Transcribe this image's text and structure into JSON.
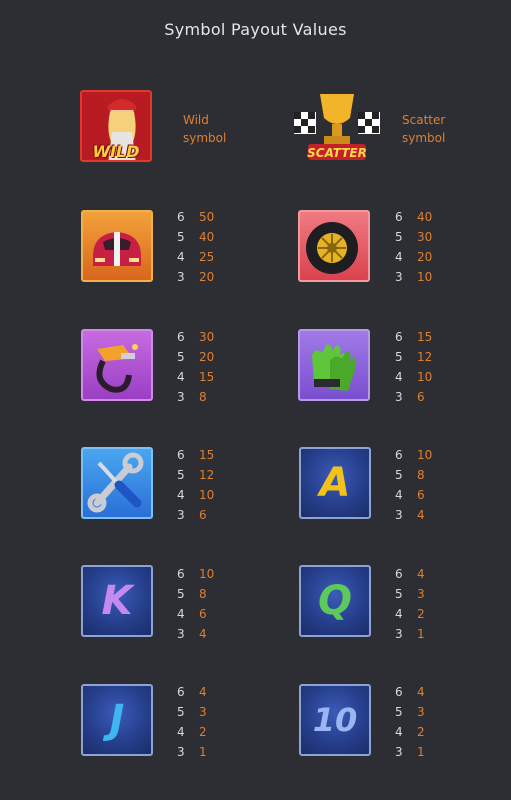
{
  "title": "Symbol Payout Values",
  "special": [
    {
      "name": "wild",
      "logo_text": "WILD",
      "label_line1": "Wild",
      "label_line2": "symbol"
    },
    {
      "name": "scatter",
      "logo_text": "SCATTER",
      "label_line1": "Scatter",
      "label_line2": "symbol"
    }
  ],
  "symbols": [
    {
      "icon": "race-car-icon",
      "pays": [
        [
          "6",
          "50"
        ],
        [
          "5",
          "40"
        ],
        [
          "4",
          "25"
        ],
        [
          "3",
          "20"
        ]
      ]
    },
    {
      "icon": "tire-icon",
      "pays": [
        [
          "6",
          "40"
        ],
        [
          "5",
          "30"
        ],
        [
          "4",
          "20"
        ],
        [
          "3",
          "10"
        ]
      ]
    },
    {
      "icon": "fuel-nozzle-icon",
      "pays": [
        [
          "6",
          "30"
        ],
        [
          "5",
          "20"
        ],
        [
          "4",
          "15"
        ],
        [
          "3",
          "8"
        ]
      ]
    },
    {
      "icon": "racing-gloves-icon",
      "pays": [
        [
          "6",
          "15"
        ],
        [
          "5",
          "12"
        ],
        [
          "4",
          "10"
        ],
        [
          "3",
          "6"
        ]
      ]
    },
    {
      "icon": "wrench-screwdriver-icon",
      "pays": [
        [
          "6",
          "15"
        ],
        [
          "5",
          "12"
        ],
        [
          "4",
          "10"
        ],
        [
          "3",
          "6"
        ]
      ]
    },
    {
      "icon": "card-a-icon",
      "letter": "A",
      "pays": [
        [
          "6",
          "10"
        ],
        [
          "5",
          "8"
        ],
        [
          "4",
          "6"
        ],
        [
          "3",
          "4"
        ]
      ]
    },
    {
      "icon": "card-k-icon",
      "letter": "K",
      "pays": [
        [
          "6",
          "10"
        ],
        [
          "5",
          "8"
        ],
        [
          "4",
          "6"
        ],
        [
          "3",
          "4"
        ]
      ]
    },
    {
      "icon": "card-q-icon",
      "letter": "Q",
      "pays": [
        [
          "6",
          "4"
        ],
        [
          "5",
          "3"
        ],
        [
          "4",
          "2"
        ],
        [
          "3",
          "1"
        ]
      ]
    },
    {
      "icon": "card-j-icon",
      "letter": "J",
      "pays": [
        [
          "6",
          "4"
        ],
        [
          "5",
          "3"
        ],
        [
          "4",
          "2"
        ],
        [
          "3",
          "1"
        ]
      ]
    },
    {
      "icon": "card-10-icon",
      "letter": "10",
      "pays": [
        [
          "6",
          "4"
        ],
        [
          "5",
          "3"
        ],
        [
          "4",
          "2"
        ],
        [
          "3",
          "1"
        ]
      ]
    }
  ],
  "colors": {
    "background": "#2c2e33",
    "payout_value": "#e07f2e",
    "count_text": "#d7d7dc",
    "card_A": "#f2c21a",
    "card_K": "#c58af0",
    "card_Q": "#5cc95a",
    "card_J": "#3fb6f0",
    "card_10": "#9bb6f2"
  }
}
